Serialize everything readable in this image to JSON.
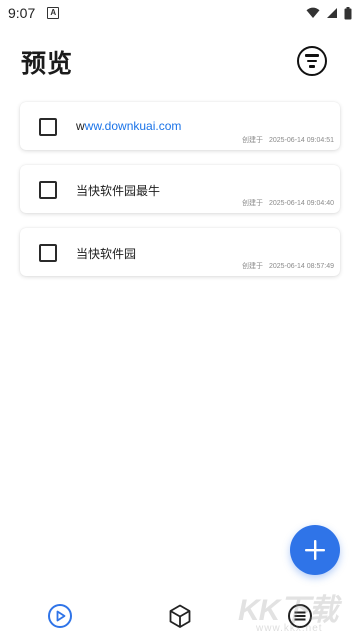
{
  "status_bar": {
    "time": "9:07",
    "notification_glyph": "A"
  },
  "header": {
    "title": "预览"
  },
  "items": [
    {
      "title_prefix": "w",
      "title_link": "ww.downkuai.com",
      "created_label": "创建于",
      "created_at": "2025-06-14 09:04:51"
    },
    {
      "title_prefix": "当快软件园最牛",
      "title_link": "",
      "created_label": "创建于",
      "created_at": "2025-06-14 09:04:40"
    },
    {
      "title_prefix": "当快软件园",
      "title_link": "",
      "created_label": "创建于",
      "created_at": "2025-06-14 08:57:49"
    }
  ],
  "watermark": {
    "logo": "KK下载",
    "url": "www.kkx.net"
  },
  "colors": {
    "accent": "#2f74e8",
    "link": "#1a73e8"
  },
  "icons": {
    "filter": "filter-circle-icon",
    "fab": "plus-icon",
    "nav": [
      "play-circle-icon",
      "cube-icon",
      "list-circle-icon"
    ]
  }
}
